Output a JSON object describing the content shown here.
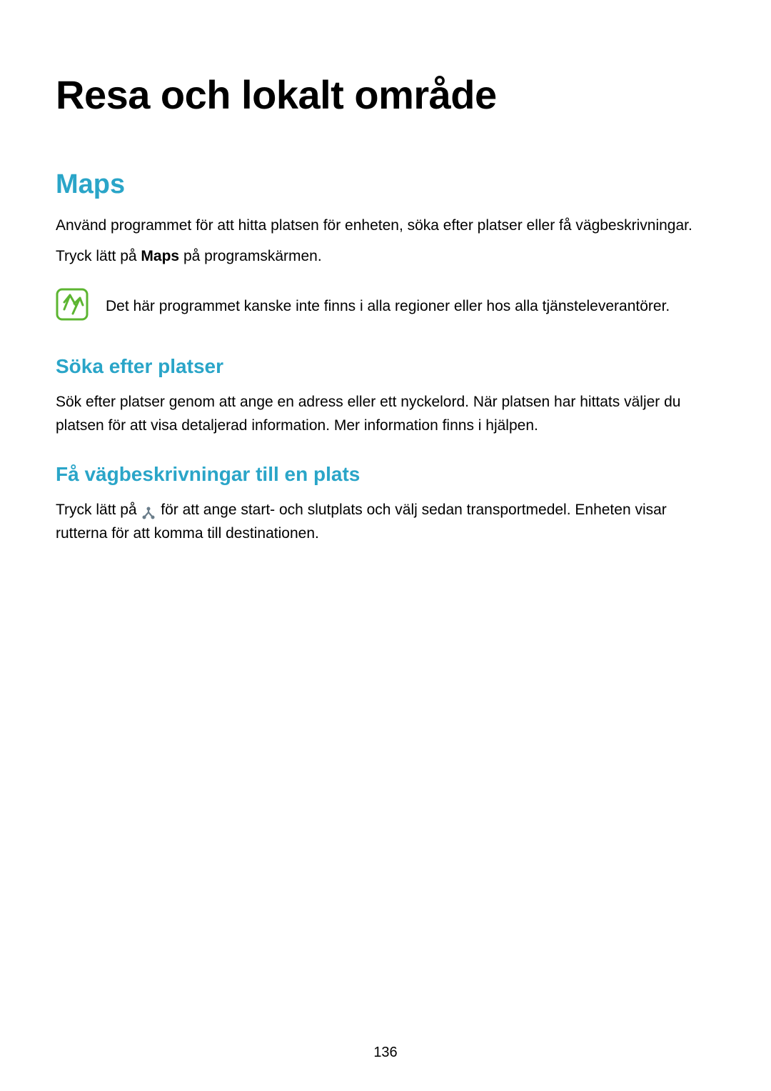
{
  "chapter": {
    "title": "Resa och lokalt område"
  },
  "section": {
    "title": "Maps",
    "intro_line1": "Använd programmet för att hitta platsen för enheten, söka efter platser eller få vägbeskrivningar.",
    "intro_line2_pre": "Tryck lätt på ",
    "intro_line2_bold": "Maps",
    "intro_line2_post": " på programskärmen."
  },
  "note": {
    "text": "Det här programmet kanske inte finns i alla regioner eller hos alla tjänsteleverantörer."
  },
  "subsection1": {
    "title": "Söka efter platser",
    "body": "Sök efter platser genom att ange en adress eller ett nyckelord. När platsen har hittats väljer du platsen för att visa detaljerad information. Mer information finns i hjälpen."
  },
  "subsection2": {
    "title": "Få vägbeskrivningar till en plats",
    "body_pre": "Tryck lätt på ",
    "body_post": " för att ange start- och slutplats och välj sedan transportmedel. Enheten visar rutterna för att komma till destinationen."
  },
  "pageNumber": "136"
}
